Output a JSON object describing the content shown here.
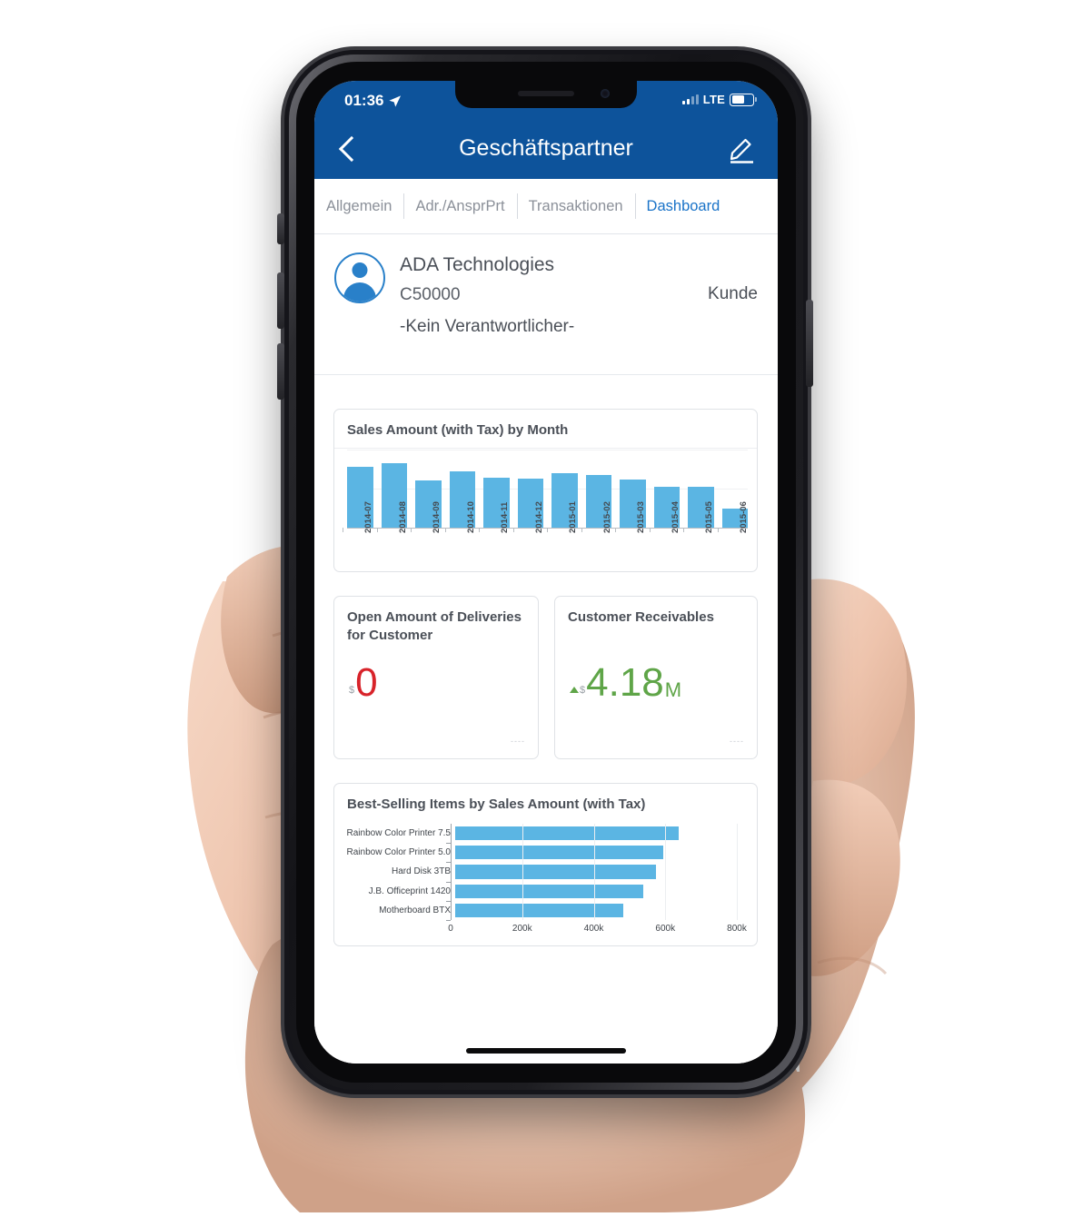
{
  "statusbar": {
    "time": "01:36",
    "location_icon": "location-arrow-icon",
    "network": "LTE",
    "battery_icon": "battery-icon",
    "signal_icon": "signal-bars-icon"
  },
  "navbar": {
    "title": "Geschäftspartner",
    "back_icon": "chevron-left-icon",
    "edit_icon": "pencil-edit-icon",
    "bg_color": "#0D539B"
  },
  "tabs": [
    {
      "label": "Allgemein",
      "active": false
    },
    {
      "label": "Adr./AnsprPrt",
      "active": false
    },
    {
      "label": "Transaktionen",
      "active": false
    },
    {
      "label": "Dashboard",
      "active": true
    }
  ],
  "profile": {
    "avatar_icon": "person-avatar-icon",
    "name": "ADA Technologies",
    "id": "C50000",
    "role": "Kunde",
    "owner": "-Kein Verantwortlicher-"
  },
  "cards": {
    "monthly": {
      "title": "Sales Amount (with Tax) by Month"
    },
    "open_amount": {
      "title": "Open Amount of Deliveries for Customer",
      "value": "0",
      "scale": "",
      "unit": "$",
      "color": "#D8232A",
      "trend_icon": "none",
      "footer": "----"
    },
    "receivables": {
      "title": "Customer Receivables",
      "value": "4.18",
      "scale": "M",
      "unit": "$",
      "color": "#5FA548",
      "trend_icon": "triangle-up-icon",
      "footer": "----"
    },
    "best_selling": {
      "title": "Best-Selling Items by Sales Amount (with Tax)"
    }
  },
  "chart_data": [
    {
      "type": "bar",
      "title": "Sales Amount (with Tax) by Month",
      "xlabel": "",
      "ylabel": "",
      "grid": true,
      "legend": "none",
      "bar_color": "#5BB5E3",
      "categories": [
        "2014-07",
        "2014-08",
        "2014-09",
        "2014-10",
        "2014-11",
        "2014-12",
        "2015-01",
        "2015-02",
        "2015-03",
        "2015-04",
        "2015-05",
        "2015-06"
      ],
      "values": [
        78,
        82,
        60,
        72,
        64,
        63,
        70,
        68,
        62,
        52,
        52,
        24
      ],
      "ylim": [
        0,
        100
      ]
    },
    {
      "type": "bar",
      "orientation": "horizontal",
      "title": "Best-Selling Items by Sales Amount (with Tax)",
      "xlabel": "",
      "ylabel": "",
      "grid": true,
      "legend": "none",
      "bar_color": "#5BB5E3",
      "categories": [
        "Rainbow Color Printer 7.5",
        "Rainbow Color Printer 5.0",
        "Hard Disk 3TB",
        "J.B. Officeprint 1420",
        "Motherboard BTX"
      ],
      "values": [
        620000,
        575000,
        555000,
        520000,
        465000
      ],
      "xticks": [
        0,
        200000,
        400000,
        600000,
        800000
      ],
      "xticklabels": [
        "0",
        "200k",
        "400k",
        "600k",
        "800k"
      ],
      "xlim": [
        0,
        800000
      ]
    }
  ]
}
